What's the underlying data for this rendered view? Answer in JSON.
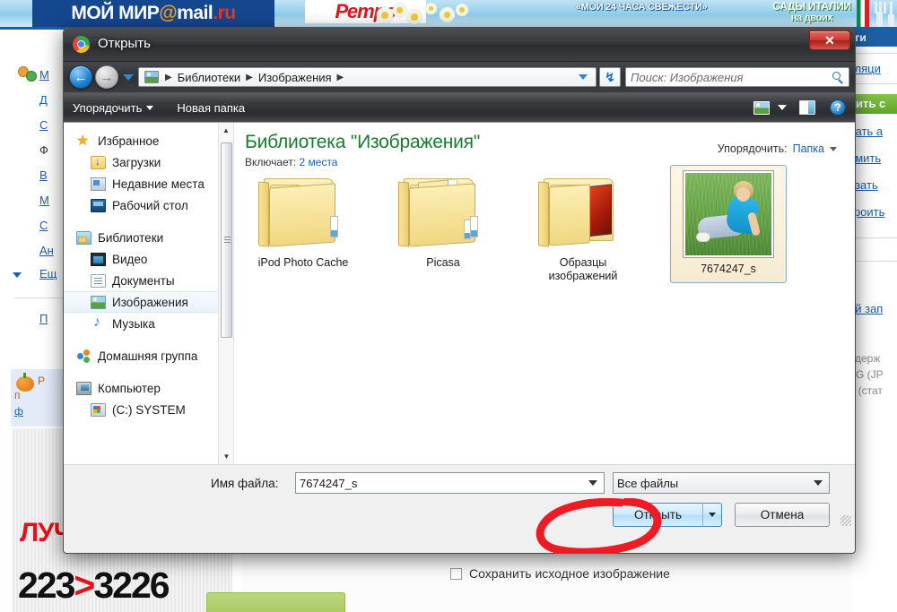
{
  "background": {
    "banner": {
      "logo_text": "МОЙ МИР",
      "logo_at": "@",
      "logo_mail": "mail",
      "logo_ru": ".ru",
      "retro_text": "Ретро",
      "slogan": "«МОИ 24 ЧАСА СВЕЖЕСТИ»",
      "italy_line1": "САДЫ ИТАЛИИ",
      "italy_line2": "на двоих"
    },
    "left_links": [
      "М",
      "Д",
      "С",
      "Ф",
      "В",
      "М",
      "С",
      "Ан",
      "Ещ",
      "П"
    ],
    "promo": {
      "line1": "Р",
      "line2": "п",
      "line3": "ф"
    },
    "right_column": {
      "header": "ьги",
      "links": [
        "сляци",
        "дать а",
        "рмить",
        "азать",
        "троить",
        "ой зап"
      ],
      "green_button": "вить с",
      "gray_lines": [
        "ддерж",
        "EG (JP",
        "F (стат"
      ]
    },
    "bottom_ad": {
      "headline": "ЛУЧ",
      "phone": "223",
      "phone_arrow": ">",
      "phone2": "3226"
    },
    "form": {
      "checkbox_label": "Сохранить исходное изображение",
      "checkbox_checked": false
    }
  },
  "dialog": {
    "title": "Открыть",
    "close_label": "✕",
    "nav": {
      "back_glyph": "←",
      "forward_glyph": "→",
      "breadcrumbs": [
        "Библиотеки",
        "Изображения"
      ],
      "separator": "▶",
      "refresh_glyph": "↯",
      "search_placeholder": "Поиск: Изображения"
    },
    "commands": {
      "organize": "Упорядочить",
      "new_folder": "Новая папка",
      "help_glyph": "?"
    },
    "navpane": {
      "groups": [
        {
          "header": {
            "label": "Избранное",
            "icon": "star-icon"
          },
          "items": [
            {
              "label": "Загрузки",
              "icon": "downloads-icon"
            },
            {
              "label": "Недавние места",
              "icon": "recent-places-icon"
            },
            {
              "label": "Рабочий стол",
              "icon": "desktop-icon"
            }
          ]
        },
        {
          "header": {
            "label": "Библиотеки",
            "icon": "libraries-icon"
          },
          "items": [
            {
              "label": "Видео",
              "icon": "video-icon"
            },
            {
              "label": "Документы",
              "icon": "documents-icon"
            },
            {
              "label": "Изображения",
              "icon": "pictures-icon",
              "selected": true
            },
            {
              "label": "Музыка",
              "icon": "music-icon"
            }
          ]
        },
        {
          "header": {
            "label": "Домашняя группа",
            "icon": "homegroup-icon"
          },
          "items": []
        },
        {
          "header": {
            "label": "Компьютер",
            "icon": "computer-icon"
          },
          "items": [
            {
              "label": "(C:) SYSTEM",
              "icon": "drive-icon"
            }
          ]
        }
      ]
    },
    "library": {
      "title": "Библиотека \"Изображения\"",
      "includes_label": "Включает:",
      "includes_value": "2 места",
      "arrange_label": "Упорядочить:",
      "arrange_value": "Папка"
    },
    "items": [
      {
        "label": "iPod Photo Cache",
        "type": "folder",
        "selected": false
      },
      {
        "label": "Picasa",
        "type": "folder-docs",
        "selected": false
      },
      {
        "label": "Образцы\nизображений",
        "label_line1": "Образцы",
        "label_line2": "изображений",
        "type": "folder-pictures",
        "selected": false
      },
      {
        "label": "7674247_s",
        "type": "image-thumbnail",
        "selected": true
      }
    ],
    "form": {
      "filename_label": "Имя файла:",
      "filename_value": "7674247_s",
      "filetype_value": "Все файлы"
    },
    "buttons": {
      "open": "Открыть",
      "cancel": "Отмена"
    }
  },
  "annotation": {
    "color": "#ef1b24",
    "target": "Открыть"
  }
}
